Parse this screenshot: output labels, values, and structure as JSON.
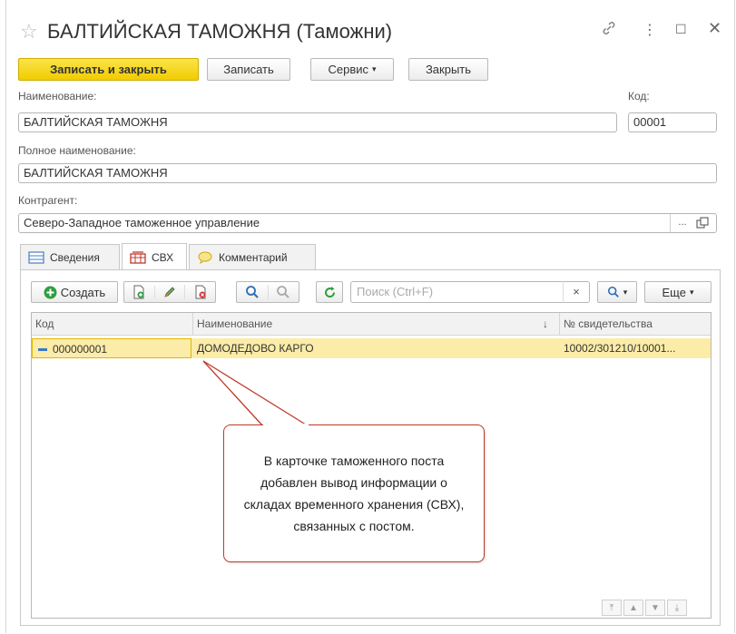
{
  "window": {
    "title": "БАЛТИЙСКАЯ ТАМОЖНЯ (Таможни)",
    "icons": [
      "star-icon",
      "link-icon",
      "more-icon",
      "maximize-icon",
      "close-icon"
    ]
  },
  "toolbar": {
    "save_close": "Записать и закрыть",
    "save": "Записать",
    "service": "Сервис",
    "close": "Закрыть"
  },
  "form": {
    "name_label": "Наименование:",
    "name_value": "БАЛТИЙСКАЯ ТАМОЖНЯ",
    "code_label": "Код:",
    "code_value": "00001",
    "full_name_label": "Полное наименование:",
    "full_name_value": "БАЛТИЙСКАЯ ТАМОЖНЯ",
    "counterparty_label": "Контрагент:",
    "counterparty_value": "Северо-Западное таможенное управление",
    "select_btn": "..."
  },
  "tabs": [
    {
      "label": "Сведения",
      "active": false
    },
    {
      "label": "СВХ",
      "active": true
    },
    {
      "label": "Комментарий",
      "active": false
    }
  ],
  "subtoolbar": {
    "create": "Создать",
    "search_placeholder": "Поиск (Ctrl+F)",
    "clear": "×",
    "more": "Еще"
  },
  "table": {
    "columns": [
      "Код",
      "Наименование",
      "№ свидетельства"
    ],
    "sort_arrow": "↓",
    "rows": [
      {
        "code": "000000001",
        "name": "ДОМОДЕДОВО КАРГО",
        "certificate": "10002/301210/10001..."
      }
    ]
  },
  "callout": {
    "text": "В карточке таможенного поста добавлен вывод информации о складах временного хранения (СВХ), связанных с постом."
  },
  "colors": {
    "primary_button": "#f1cc00",
    "selected_row": "#fbeca8",
    "callout_border": "#c0392b",
    "create_icon": "#2e9e3e"
  }
}
